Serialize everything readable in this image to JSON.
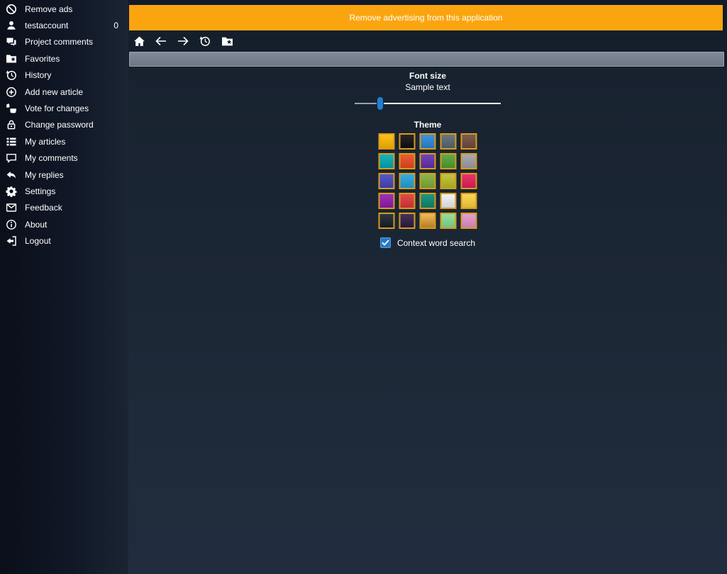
{
  "sidebar": {
    "items": [
      {
        "icon": "remove-ads-icon",
        "label": "Remove ads"
      },
      {
        "icon": "account-icon",
        "label": "testaccount",
        "badge": "0"
      },
      {
        "icon": "project-comments-icon",
        "label": "Project comments"
      },
      {
        "icon": "favorites-icon",
        "label": "Favorites"
      },
      {
        "icon": "history-icon",
        "label": "History"
      },
      {
        "icon": "add-new-article-icon",
        "label": "Add new article"
      },
      {
        "icon": "vote-for-changes-icon",
        "label": "Vote for changes"
      },
      {
        "icon": "change-password-icon",
        "label": "Change password"
      },
      {
        "icon": "my-articles-icon",
        "label": "My articles"
      },
      {
        "icon": "my-comments-icon",
        "label": "My comments"
      },
      {
        "icon": "my-replies-icon",
        "label": "My replies"
      },
      {
        "icon": "settings-icon",
        "label": "Settings"
      },
      {
        "icon": "feedback-icon",
        "label": "Feedback"
      },
      {
        "icon": "about-icon",
        "label": "About"
      },
      {
        "icon": "logout-icon",
        "label": "Logout"
      }
    ]
  },
  "banner": {
    "text": "Remove advertising from this application",
    "color": "#faa50f"
  },
  "toolbar": {
    "buttons": [
      {
        "name": "home",
        "icon": "home-icon",
        "disabled": false
      },
      {
        "name": "back",
        "icon": "back-icon",
        "disabled": true
      },
      {
        "name": "forward",
        "icon": "forward-icon",
        "disabled": true
      },
      {
        "name": "history",
        "icon": "history-icon",
        "disabled": false
      },
      {
        "name": "favorites",
        "icon": "favorites-folder-icon",
        "disabled": false
      }
    ]
  },
  "address_bar": {
    "value": ""
  },
  "settings_page": {
    "font_size": {
      "title": "Font size",
      "sample_text": "Sample text",
      "slider_percent": 17.5,
      "thumb_color": "#1f7ed6"
    },
    "theme": {
      "title": "Theme",
      "swatch_border": "#d89b1c",
      "swatches": [
        {
          "fill": "#ffb900"
        },
        {
          "fill": "#0e0e10"
        },
        {
          "fill": "#2b88d8"
        },
        {
          "fill": "#586874"
        },
        {
          "fill": "#6f4b3a"
        },
        {
          "fill": "#00aab4"
        },
        {
          "fill": "#e9491f"
        },
        {
          "fill": "#6230af"
        },
        {
          "fill": "#50a033"
        },
        {
          "fill": "#a0a0a8"
        },
        {
          "fill": "#4545c2"
        },
        {
          "fill": "#23a3dd"
        },
        {
          "fill": "#7fae38"
        },
        {
          "fill": "#bebe29"
        },
        {
          "fill": "#e61e5a"
        },
        {
          "fill": "#921bb0"
        },
        {
          "fill": "#de3738"
        },
        {
          "fill": "#0b8a72"
        },
        {
          "fill": "#f1f1f6"
        },
        {
          "fill": "#fed23f"
        },
        {
          "fill": "#161f2b"
        },
        {
          "fill": "#2e1d45"
        },
        {
          "fill": "#f0b447",
          "fill2": "#d18f27"
        },
        {
          "fill": "#88dd92"
        },
        {
          "fill": "#e394c9"
        }
      ]
    },
    "context_search": {
      "label": "Context word search",
      "checked": true,
      "accent": "#2779c4"
    }
  }
}
